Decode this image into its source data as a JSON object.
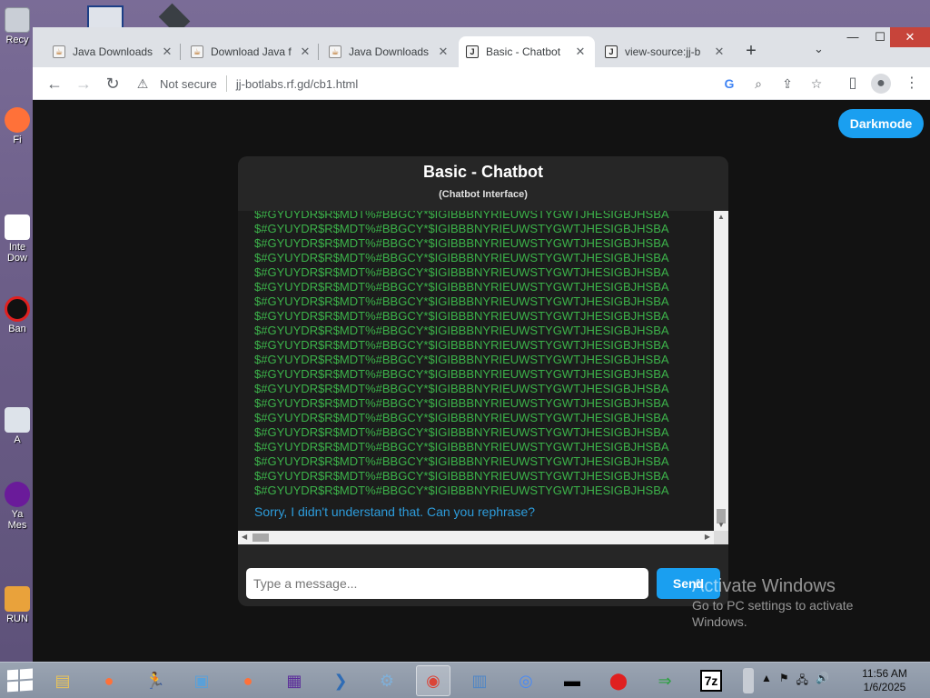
{
  "desktop": {
    "icons": [
      {
        "label": "Recy",
        "icon": "recycle-bin-icon"
      },
      {
        "label": "Fi",
        "icon": "firefox-shortcut-icon"
      },
      {
        "label": "Inte Dow",
        "icon": "internet-download-icon"
      },
      {
        "label": "Ban",
        "icon": "bandicam-icon"
      },
      {
        "label": "A",
        "icon": "shortcut-icon"
      },
      {
        "label": "Ya Mes",
        "icon": "yahoo-messenger-icon"
      },
      {
        "label": "RUN",
        "icon": "run-icon"
      }
    ]
  },
  "browser": {
    "tabs": [
      {
        "label": "Java Downloads",
        "favicon": "java-icon"
      },
      {
        "label": "Download Java f",
        "favicon": "java-icon"
      },
      {
        "label": "Java Downloads",
        "favicon": "java-icon"
      },
      {
        "label": "Basic - Chatbot",
        "favicon": "jj-icon",
        "active": true
      },
      {
        "label": "view-source:jj-b",
        "favicon": "jj-icon"
      }
    ],
    "new_tab": "+",
    "tab_search": "⌄",
    "window_controls": {
      "minimize": "—",
      "maximize": "☐",
      "close": "✕"
    },
    "toolbar": {
      "back": "←",
      "forward": "→",
      "reload": "↻",
      "not_secure": "Not secure",
      "url": "jj-botlabs.rf.gd/cb1.html"
    }
  },
  "page": {
    "darkmode_label": "Darkmode",
    "chat": {
      "title": "Basic - Chatbot",
      "subtitle": "(Chatbot Interface)",
      "repeated_line": "$#GYUYDR$R$MDT%#BBGCY*$IGIBBBNYRIEUWSTYGWTJHESIGBJHSBA",
      "repeat_count": 20,
      "bot_reply": "Sorry, I didn't understand that. Can you rephrase?",
      "input_placeholder": "Type a message...",
      "send_label": "Send"
    }
  },
  "watermark": {
    "title": "Activate Windows",
    "subtitle": "Go to PC settings to activate Windows."
  },
  "taskbar": {
    "apps": [
      {
        "name": "file-explorer-icon",
        "glyph": "▤",
        "color": "#e8c35a"
      },
      {
        "name": "firefox-icon",
        "glyph": "●",
        "color": "#ff7139"
      },
      {
        "name": "runner-icon",
        "glyph": "🏃",
        "color": "#ffffff"
      },
      {
        "name": "image-viewer-icon",
        "glyph": "▣",
        "color": "#5aa0d8"
      },
      {
        "name": "firefox-alt-icon",
        "glyph": "●",
        "color": "#ff7139"
      },
      {
        "name": "chip-app-icon",
        "glyph": "▦",
        "color": "#5b2c9a"
      },
      {
        "name": "powershell-icon",
        "glyph": "❯",
        "color": "#2f6cb5"
      },
      {
        "name": "tools-icon",
        "glyph": "⚙",
        "color": "#7fb0d9"
      },
      {
        "name": "chrome-icon",
        "glyph": "◉",
        "color": "#db4437",
        "active": true
      },
      {
        "name": "control-panel-icon",
        "glyph": "▥",
        "color": "#4f86c6"
      },
      {
        "name": "chromium-icon",
        "glyph": "◎",
        "color": "#4a8af4"
      },
      {
        "name": "command-prompt-icon",
        "glyph": "▬",
        "color": "#000000"
      },
      {
        "name": "record-icon",
        "glyph": "⬤",
        "color": "#e02020"
      },
      {
        "name": "terminal-arrow-icon",
        "glyph": "⇒",
        "color": "#2ea043"
      },
      {
        "name": "7zip-icon",
        "glyph": "7z",
        "color": "#000000"
      }
    ],
    "tray": [
      "▲",
      "⚑",
      "🖧",
      "🔊"
    ],
    "clock_time": "11:56 AM",
    "clock_date": "1/6/2025"
  }
}
